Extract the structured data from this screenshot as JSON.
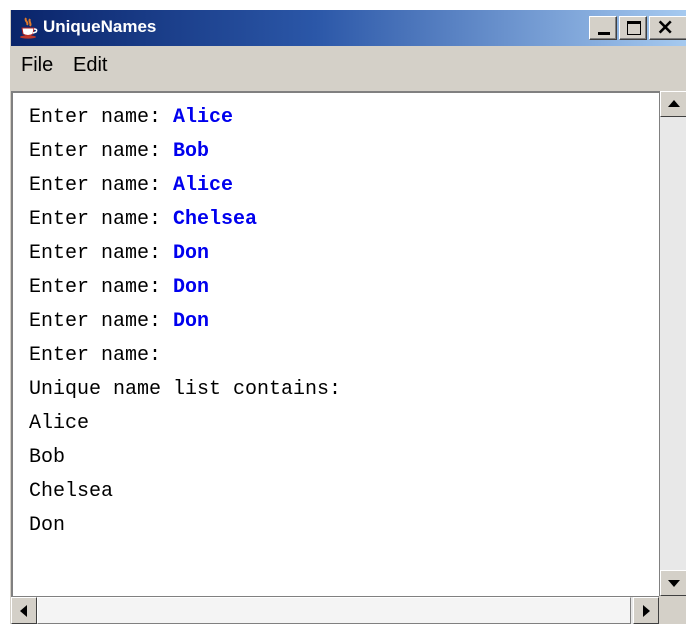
{
  "window": {
    "title": "UniqueNames",
    "icon": "java-cup-icon",
    "controls": [
      "minimize-icon",
      "maximize-icon",
      "close-icon"
    ]
  },
  "menu": {
    "items": [
      "File",
      "Edit"
    ]
  },
  "console": {
    "prompt_lines": [
      {
        "prompt": "Enter name: ",
        "input": "Alice"
      },
      {
        "prompt": "Enter name: ",
        "input": "Bob"
      },
      {
        "prompt": "Enter name: ",
        "input": "Alice"
      },
      {
        "prompt": "Enter name: ",
        "input": "Chelsea"
      },
      {
        "prompt": "Enter name: ",
        "input": "Don"
      },
      {
        "prompt": "Enter name: ",
        "input": "Don"
      },
      {
        "prompt": "Enter name: ",
        "input": "Don"
      },
      {
        "prompt": "Enter name:",
        "input": ""
      }
    ],
    "output_lines": [
      "Unique name list contains:",
      "Alice",
      "Bob",
      "Chelsea",
      "Don"
    ]
  },
  "colors": {
    "typed_input": "#0000ee",
    "title_bar_start": "#0a246a",
    "title_bar_end": "#a6caf0",
    "chrome": "#d4d0c8"
  }
}
